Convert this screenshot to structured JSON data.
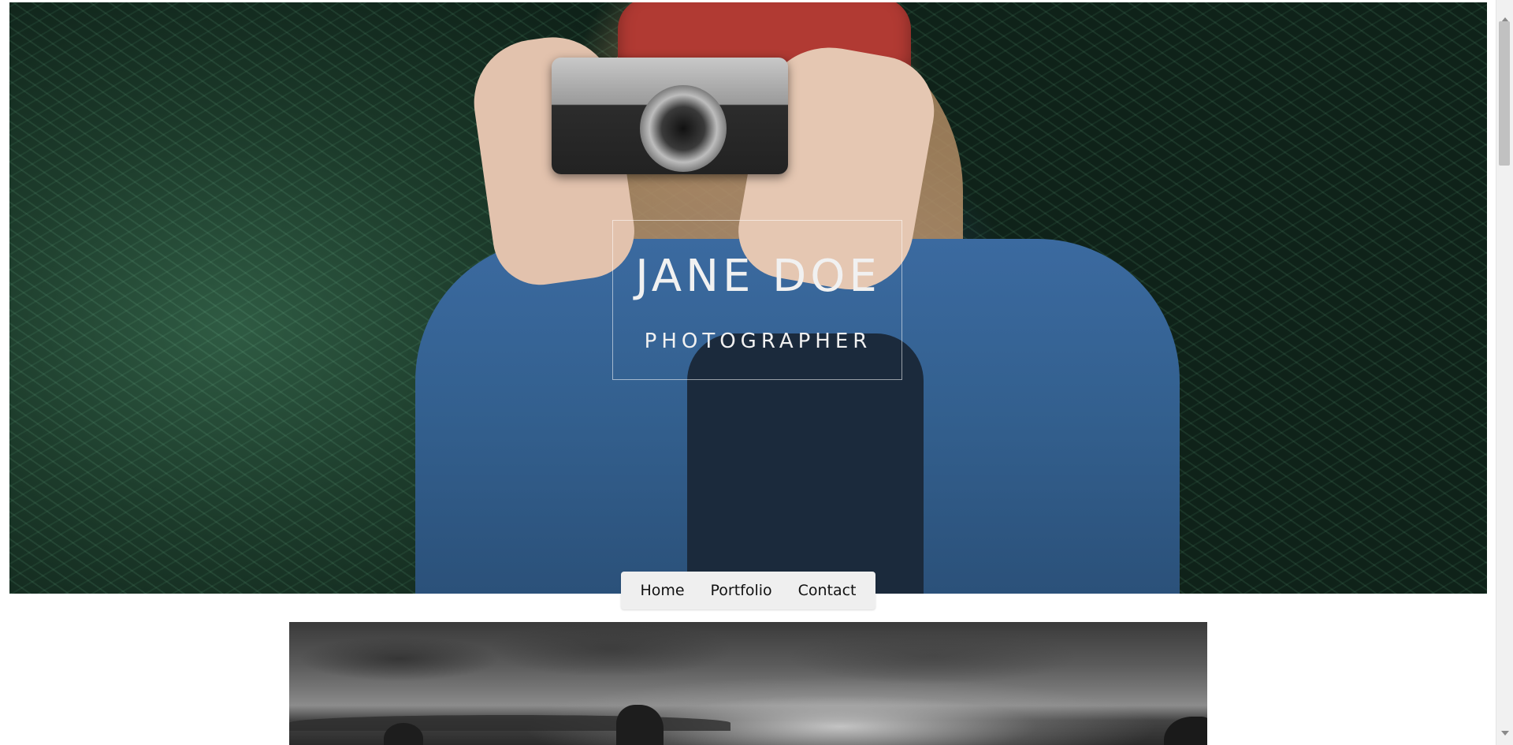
{
  "hero": {
    "name": "JANE DOE",
    "role": "PHOTOGRAPHER"
  },
  "nav": {
    "items": [
      {
        "label": "Home"
      },
      {
        "label": "Portfolio"
      },
      {
        "label": "Contact"
      }
    ]
  },
  "colors": {
    "nav_background": "#efefef",
    "title_text": "#f1f1f1",
    "page_background": "#ffffff"
  },
  "icons": {
    "scroll_up": "triangle-up",
    "scroll_down": "triangle-down"
  }
}
